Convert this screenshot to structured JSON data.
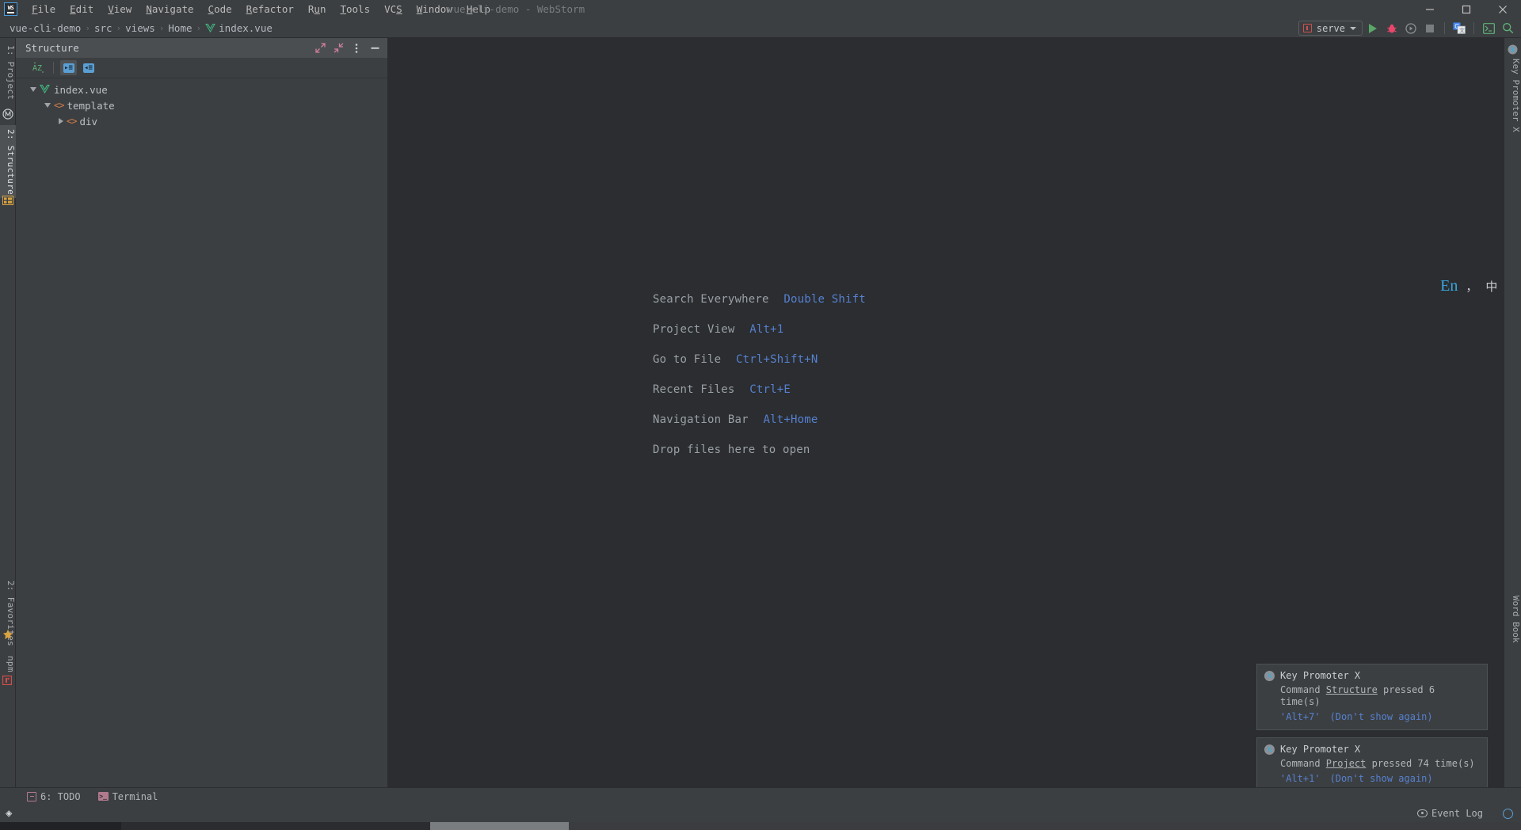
{
  "window": {
    "title": "vue-cli-demo - WebStorm",
    "minimize_label": "minimize-icon",
    "maximize_label": "maximize-icon",
    "close_label": "close-icon"
  },
  "menubar": {
    "logo": "webstorm-logo",
    "items": [
      {
        "label": "File",
        "mnemonic": "F"
      },
      {
        "label": "Edit",
        "mnemonic": "E"
      },
      {
        "label": "View",
        "mnemonic": "V"
      },
      {
        "label": "Navigate",
        "mnemonic": "N"
      },
      {
        "label": "Code",
        "mnemonic": "C"
      },
      {
        "label": "Refactor",
        "mnemonic": "R"
      },
      {
        "label": "Run",
        "mnemonic": "u"
      },
      {
        "label": "Tools",
        "mnemonic": "T"
      },
      {
        "label": "VCS",
        "mnemonic": "S"
      },
      {
        "label": "Window",
        "mnemonic": "W"
      },
      {
        "label": "Help",
        "mnemonic": "H"
      }
    ]
  },
  "breadcrumb": {
    "items": [
      "vue-cli-demo",
      "src",
      "views",
      "Home",
      "index.vue"
    ],
    "separator": "›",
    "file_icon": "vue-file-icon"
  },
  "toolbar": {
    "run_config": {
      "label": "serve",
      "icon": "npm-icon",
      "dropdown_icon": "chevron-down-icon"
    },
    "buttons": [
      {
        "name": "run-button",
        "icon": "play-icon"
      },
      {
        "name": "debug-button",
        "icon": "bug-icon"
      },
      {
        "name": "run-with-coverage-button",
        "icon": "coverage-icon"
      },
      {
        "name": "stop-button",
        "icon": "stop-icon"
      },
      {
        "name": "translate-button",
        "icon": "google-translate-icon"
      },
      {
        "name": "terminal-button",
        "icon": "terminal-icon"
      },
      {
        "name": "search-button",
        "icon": "search-icon"
      }
    ]
  },
  "left_tool_tabs": [
    {
      "label": "1: Project",
      "icon": "project-icon",
      "active": false
    },
    {
      "label": "2: Structure",
      "icon": "structure-icon",
      "active": true
    },
    {
      "label": "2: Favorites",
      "icon": "star-icon",
      "active": false
    },
    {
      "label": "npm",
      "icon": "npm-icon",
      "active": false
    }
  ],
  "right_tool_tabs": [
    {
      "label": "Key Promoter X",
      "icon": "key-promoter-icon"
    },
    {
      "label": "Word Book",
      "icon": "word-book-icon"
    }
  ],
  "structure_panel": {
    "title": "Structure",
    "header_buttons": [
      {
        "name": "expand-window-button",
        "icon": "expand-arrows-icon"
      },
      {
        "name": "collapse-window-button",
        "icon": "collapse-arrows-icon"
      },
      {
        "name": "options-button",
        "icon": "more-vertical-icon"
      },
      {
        "name": "hide-button",
        "icon": "minus-icon"
      }
    ],
    "toolbar_buttons": [
      {
        "name": "sort-alphabetically-button",
        "icon": "sort-az-icon",
        "active": false
      },
      {
        "name": "expand-all-button",
        "icon": "expand-all-icon",
        "active": true
      },
      {
        "name": "collapse-all-button",
        "icon": "collapse-all-icon",
        "active": false
      }
    ],
    "tree": [
      {
        "label": "index.vue",
        "icon": "vue-file-icon",
        "indent": 0,
        "twisty": "down"
      },
      {
        "label": "template",
        "icon": "html-tag-icon",
        "indent": 1,
        "twisty": "down"
      },
      {
        "label": "div",
        "icon": "html-tag-icon",
        "indent": 2,
        "twisty": "right"
      }
    ]
  },
  "editor": {
    "hints": [
      {
        "action": "Search Everywhere",
        "shortcut": "Double Shift"
      },
      {
        "action": "Project View",
        "shortcut": "Alt+1"
      },
      {
        "action": "Go to File",
        "shortcut": "Ctrl+Shift+N"
      },
      {
        "action": "Recent Files",
        "shortcut": "Ctrl+E"
      },
      {
        "action": "Navigation Bar",
        "shortcut": "Alt+Home"
      },
      {
        "action": "Drop files here to open",
        "shortcut": ""
      }
    ]
  },
  "language_widget": {
    "lang": "En",
    "dot": "·",
    "comma": "，",
    "cn": "中",
    "keyboard": "keyboard-icon"
  },
  "notifications": [
    {
      "title": "Key Promoter X",
      "icon": "key-promoter-icon",
      "body_prefix": "Command ",
      "body_command": "Structure",
      "body_suffix": " pressed 6 time(s)",
      "shortcut": "'Alt+7'",
      "dismiss": "(Don't show again)"
    },
    {
      "title": "Key Promoter X",
      "icon": "key-promoter-icon",
      "body_prefix": "Command ",
      "body_command": "Project",
      "body_suffix": " pressed 74 time(s)",
      "shortcut": "'Alt+1'",
      "dismiss": "(Don't show again)"
    }
  ],
  "bottom_bar": {
    "tabs": [
      {
        "label": "6: TODO",
        "mnemonic": "6",
        "icon": "todo-icon"
      },
      {
        "label": "Terminal",
        "icon": "terminal-icon"
      }
    ]
  },
  "status_bar": {
    "layers_icon": "layers-icon",
    "event_log": "Event Log",
    "event_log_icon": "eye-icon",
    "globe_icon": "globe-icon"
  },
  "colors": {
    "background": "#2b2d30",
    "panel": "#3c3f41",
    "accent_blue": "#5680d0",
    "vue_green": "#41b883",
    "tag_orange": "#cf7b4a",
    "run_green": "#59a869",
    "text": "#bcc0c5"
  }
}
